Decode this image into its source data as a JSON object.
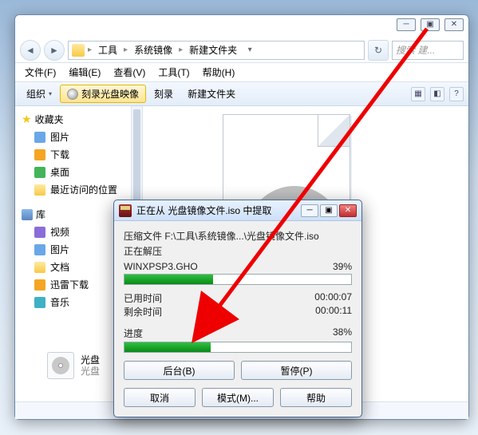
{
  "explorer": {
    "nav_back": "◄",
    "nav_fwd": "►",
    "breadcrumb": [
      "工具",
      "系统镜像",
      "新建文件夹"
    ],
    "refresh": "↻",
    "search_placeholder": "搜索 建...",
    "menus": [
      "文件(F)",
      "编辑(E)",
      "查看(V)",
      "工具(T)",
      "帮助(H)"
    ],
    "toolbar": {
      "organize": "组织",
      "burn": "刻录光盘映像",
      "record": "刻录",
      "newfolder": "新建文件夹"
    },
    "sidebar": {
      "favorites_hdr": "收藏夹",
      "favorites": [
        {
          "label": "图片",
          "cls": "ic-blue"
        },
        {
          "label": "下载",
          "cls": "ic-orange"
        },
        {
          "label": "桌面",
          "cls": "ic-green"
        },
        {
          "label": "最近访问的位置",
          "cls": "ic-folder"
        }
      ],
      "libraries_hdr": "库",
      "libraries": [
        {
          "label": "视频",
          "cls": "ic-purple"
        },
        {
          "label": "图片",
          "cls": "ic-blue"
        },
        {
          "label": "文档",
          "cls": "ic-folder"
        },
        {
          "label": "迅雷下载",
          "cls": "ic-orange"
        },
        {
          "label": "音乐",
          "cls": "ic-teal"
        }
      ]
    },
    "iso_item": {
      "name": "光盘",
      "type": "光盘"
    },
    "winctl": {
      "min": "─",
      "max": "▣",
      "close": "✕"
    }
  },
  "dialog": {
    "title": "正在从 光盘镜像文件.iso 中提取",
    "arch_label": "压缩文件 F:\\工具\\系统镜像...\\光盘镜像文件.iso",
    "extracting": "正在解压",
    "current_file": "WINXPSP3.GHO",
    "file_pct": "39%",
    "file_pct_val": 39,
    "elapsed_label": "已用时间",
    "elapsed": "00:00:07",
    "remain_label": "剩余时间",
    "remain": "00:00:11",
    "progress_label": "进度",
    "progress_pct": "38%",
    "progress_pct_val": 38,
    "btn_bg": "后台(B)",
    "btn_pause": "暂停(P)",
    "btn_cancel": "取消",
    "btn_mode": "模式(M)...",
    "btn_help": "帮助",
    "winctl": {
      "min": "─",
      "max": "▣",
      "close": "✕"
    }
  }
}
